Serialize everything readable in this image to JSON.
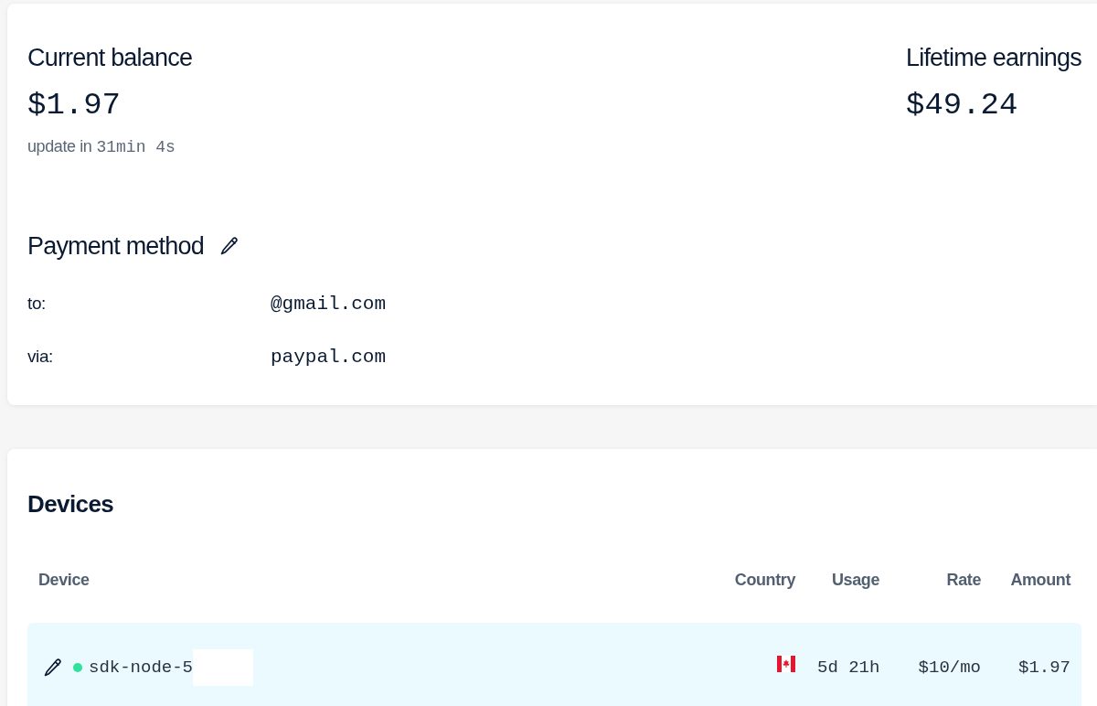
{
  "balance": {
    "label": "Current balance",
    "amount": "$1.97",
    "update_label": "update in",
    "update_countdown": "31min 4s"
  },
  "lifetime": {
    "label": "Lifetime earnings",
    "amount": "$49.24"
  },
  "payment_method": {
    "title": "Payment method",
    "fields": [
      {
        "label": "to:",
        "value": "@gmail.com"
      },
      {
        "label": "via:",
        "value": "paypal.com"
      }
    ]
  },
  "devices": {
    "title": "Devices",
    "columns": [
      "Device",
      "Country",
      "Usage",
      "Rate",
      "Amount"
    ],
    "rows": [
      {
        "name": "sdk-node-5",
        "color": "#2fe29c",
        "usage": "5d 21h",
        "rate": "$10/mo",
        "amount": "$1.97"
      }
    ]
  }
}
